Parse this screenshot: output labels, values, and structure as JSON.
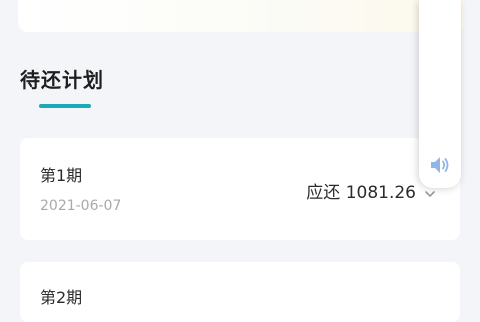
{
  "section": {
    "title": "待还计划"
  },
  "plans": [
    {
      "period": "第1期",
      "date": "2021-06-07",
      "amount": "应还 1081.26"
    },
    {
      "period": "第2期"
    }
  ],
  "colors": {
    "accent": "#1aa9b8",
    "background": "#f3f5f8"
  },
  "icons": {
    "expand": "chevron-down-icon",
    "volume": "speaker-icon"
  }
}
